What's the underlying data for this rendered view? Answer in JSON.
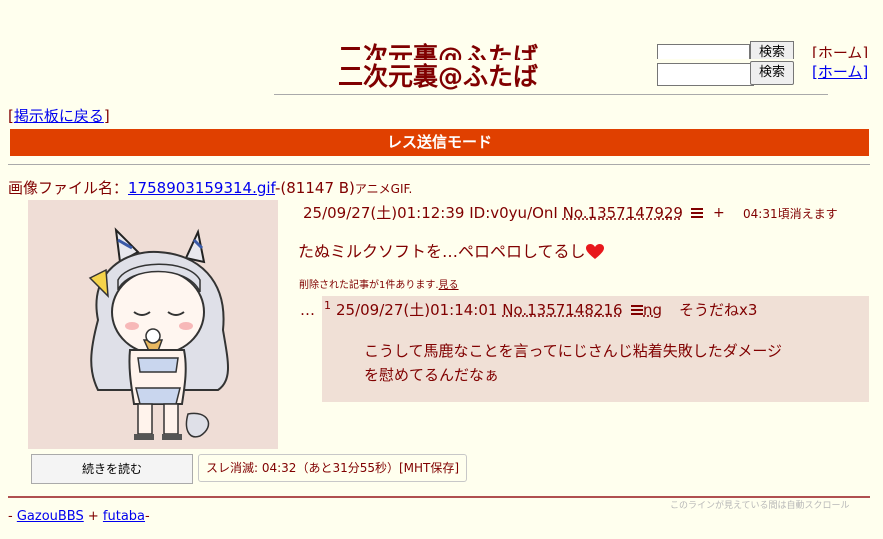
{
  "header": {
    "title": "二次元裏@ふたば",
    "search_button": "検索",
    "home_link": "[ホーム]"
  },
  "nav": {
    "back_prefix": "[",
    "back_link": "掲示板に戻る",
    "back_suffix": "]"
  },
  "mode_bar": "レス送信モード",
  "file": {
    "label": "画像ファイル名：",
    "name": "1758903159314.gif",
    "size": "-(81147 B)",
    "type": "アニメGIF."
  },
  "op": {
    "date": "25/09/27(土)01:12:39",
    "id": "ID:v0yu/OnI",
    "no": "No.1357147929",
    "plus": "+",
    "expire_note": "04:31頃消えます",
    "body": "たぬミルクソフトを…ペロペロしてるし"
  },
  "deleted": {
    "text": "削除された記事が1件あります.",
    "link": "見る"
  },
  "reply": {
    "dots": "…",
    "num": "1",
    "date": "25/09/27(土)01:14:01",
    "no": "No.1357148216",
    "ng": "ng",
    "sodane": "そうだねx3",
    "body_line1": "こうして馬鹿なことを言ってにじさんじ粘着失敗したダメージ",
    "body_line2": "を慰めてるんだなぁ"
  },
  "controls": {
    "more_button": "続きを読む",
    "expire_box": "スレ消滅: 04:32（あと31分55秒）[MHT保存]",
    "autoscroll_note": "このラインが見えている間は自動スクロール"
  },
  "footer": {
    "prefix": "- ",
    "gazoubbs": "GazouBBS",
    "plus": " + ",
    "futaba": "futaba",
    "suffix": "-"
  },
  "colors": {
    "background": "#ffffee",
    "text": "#800000",
    "mode_bar": "#e04000",
    "reply_bg": "#f0e0d6",
    "link": "#0000ee"
  },
  "icons": {
    "menu": "menu-lines-icon",
    "heart": "heart-icon",
    "thumbnail": "anime-girl-image"
  }
}
